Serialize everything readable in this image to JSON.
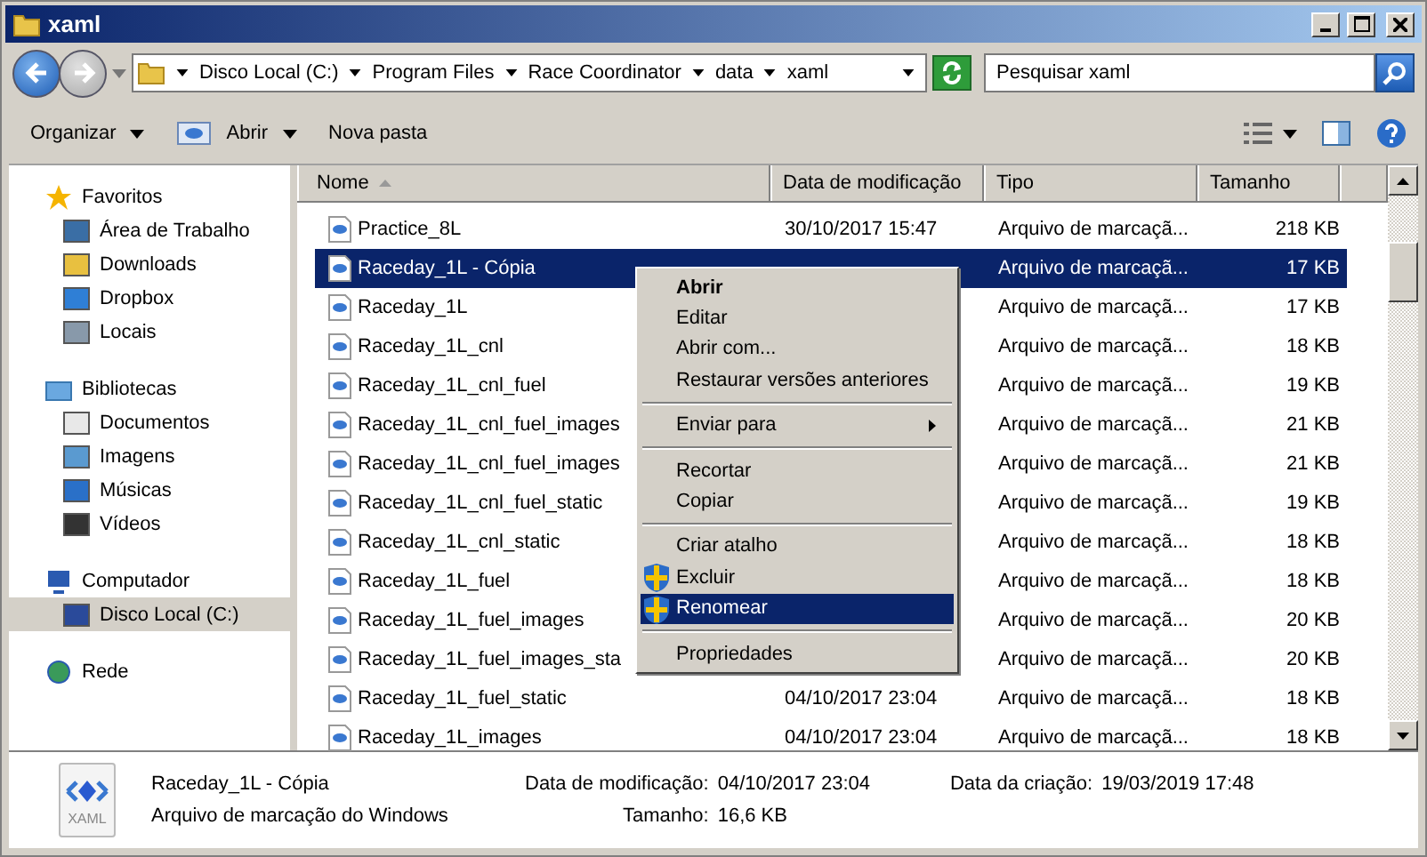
{
  "window": {
    "title": "xaml"
  },
  "address_bar": {
    "path": [
      "Disco Local (C:)",
      "Program Files",
      "Race Coordinator",
      "data",
      "xaml"
    ]
  },
  "search": {
    "placeholder": "Pesquisar xaml"
  },
  "toolbar": {
    "buttons": [
      {
        "label": "Organizar",
        "dropdown": true
      },
      {
        "label": "Abrir",
        "dropdown": true
      },
      {
        "label": "Nova pasta",
        "dropdown": false
      }
    ]
  },
  "sidebar": {
    "sections": [
      {
        "label": "Favoritos",
        "items": [
          {
            "label": "Área de Trabalho",
            "selected": false
          },
          {
            "label": "Downloads",
            "selected": false
          },
          {
            "label": "Dropbox",
            "selected": false
          },
          {
            "label": "Locais",
            "selected": false
          }
        ]
      },
      {
        "label": "Bibliotecas",
        "items": [
          {
            "label": "Documentos",
            "selected": false
          },
          {
            "label": "Imagens",
            "selected": false
          },
          {
            "label": "Músicas",
            "selected": false
          },
          {
            "label": "Vídeos",
            "selected": false
          }
        ]
      },
      {
        "label": "Computador",
        "items": [
          {
            "label": "Disco Local (C:)",
            "selected": true
          }
        ]
      },
      {
        "label": "Rede"
      }
    ]
  },
  "table": {
    "columns": [
      "Nome",
      "Data de modificação",
      "Tipo",
      "Tamanho"
    ],
    "rows": [
      {
        "name": "Practice_8L",
        "date": "30/10/2017 15:47",
        "type": "Arquivo de marcaçã...",
        "size": "218 KB",
        "selected": false
      },
      {
        "name": "Raceday_1L - Cópia",
        "type": "Arquivo de marcaçã...",
        "size": "17 KB",
        "selected": true
      },
      {
        "name": "Raceday_1L",
        "type": "Arquivo de marcaçã...",
        "size": "17 KB",
        "selected": false
      },
      {
        "name": "Raceday_1L_cnl",
        "type": "Arquivo de marcaçã...",
        "size": "18 KB",
        "selected": false
      },
      {
        "name": "Raceday_1L_cnl_fuel",
        "type": "Arquivo de marcaçã...",
        "size": "19 KB",
        "selected": false
      },
      {
        "name": "Raceday_1L_cnl_fuel_images",
        "type": "Arquivo de marcaçã...",
        "size": "21 KB",
        "selected": false
      },
      {
        "name": "Raceday_1L_cnl_fuel_images",
        "type": "Arquivo de marcaçã...",
        "size": "21 KB",
        "selected": false
      },
      {
        "name": "Raceday_1L_cnl_fuel_static",
        "type": "Arquivo de marcaçã...",
        "size": "19 KB",
        "selected": false
      },
      {
        "name": "Raceday_1L_cnl_static",
        "type": "Arquivo de marcaçã...",
        "size": "18 KB",
        "selected": false
      },
      {
        "name": "Raceday_1L_fuel",
        "type": "Arquivo de marcaçã...",
        "size": "18 KB",
        "selected": false
      },
      {
        "name": "Raceday_1L_fuel_images",
        "type": "Arquivo de marcaçã...",
        "size": "20 KB",
        "selected": false
      },
      {
        "name": "Raceday_1L_fuel_images_sta",
        "type": "Arquivo de marcaçã...",
        "size": "20 KB",
        "selected": false
      },
      {
        "name": "Raceday_1L_fuel_static",
        "date": "04/10/2017 23:04",
        "type": "Arquivo de marcaçã...",
        "size": "18 KB",
        "selected": false
      },
      {
        "name": "Raceday_1L_images",
        "date": "04/10/2017 23:04",
        "type": "Arquivo de marcaçã...",
        "size": "18 KB",
        "selected": false
      }
    ]
  },
  "context_menu": {
    "groups": [
      [
        {
          "label": "Abrir",
          "default": true,
          "submenu": false,
          "elevated": false,
          "selected": false
        },
        {
          "label": "Editar",
          "default": false,
          "submenu": false,
          "elevated": false,
          "selected": false
        },
        {
          "label": "Abrir com...",
          "default": false,
          "submenu": false,
          "elevated": false,
          "selected": false
        },
        {
          "label": "Restaurar versões anteriores",
          "default": false,
          "submenu": false,
          "elevated": false,
          "selected": false
        }
      ],
      [
        {
          "label": "Enviar para",
          "default": false,
          "submenu": true,
          "elevated": false,
          "selected": false
        }
      ],
      [
        {
          "label": "Recortar",
          "default": false,
          "submenu": false,
          "elevated": false,
          "selected": false
        },
        {
          "label": "Copiar",
          "default": false,
          "submenu": false,
          "elevated": false,
          "selected": false
        }
      ],
      [
        {
          "label": "Criar atalho",
          "default": false,
          "submenu": false,
          "elevated": false,
          "selected": false
        },
        {
          "label": "Excluir",
          "default": false,
          "submenu": false,
          "elevated": true,
          "selected": false
        },
        {
          "label": "Renomear",
          "default": false,
          "submenu": false,
          "elevated": true,
          "selected": true
        }
      ],
      [
        {
          "label": "Propriedades",
          "default": false,
          "submenu": false,
          "elevated": false,
          "selected": false
        }
      ]
    ]
  },
  "details": {
    "name": "Raceday_1L - Cópia",
    "type": "Arquivo de marcação do Windows",
    "icon_label": "XAML",
    "fields": [
      {
        "label": "Data de modificação:",
        "value": "04/10/2017 23:04"
      },
      {
        "label": "Tamanho:",
        "value": "16,6 KB"
      },
      {
        "label": "Data da criação:",
        "value": "19/03/2019 17:48"
      }
    ]
  }
}
